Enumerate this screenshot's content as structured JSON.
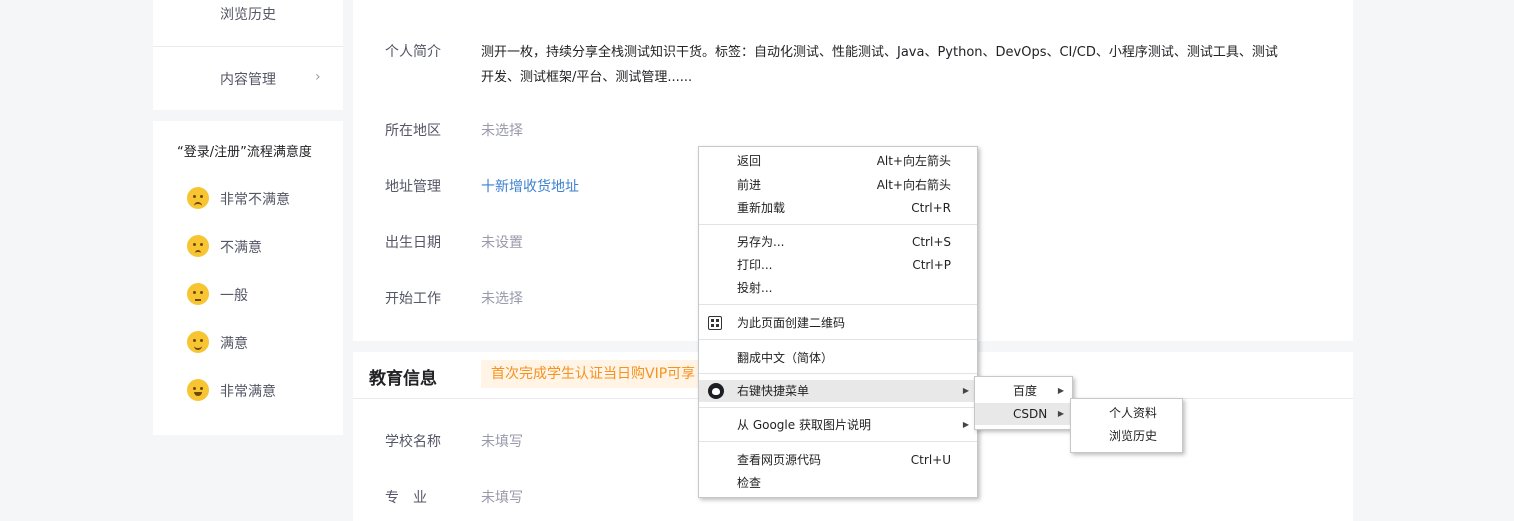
{
  "sidebar": {
    "items": [
      {
        "label": "浏览历史"
      },
      {
        "label": "内容管理",
        "chevron": "›"
      }
    ]
  },
  "survey": {
    "title": "“登录/注册”流程满意度",
    "options": [
      {
        "label": "非常不满意",
        "icon": "angry-face-icon"
      },
      {
        "label": "不满意",
        "icon": "worried-face-icon"
      },
      {
        "label": "一般",
        "icon": "neutral-face-icon"
      },
      {
        "label": "满意",
        "icon": "smile-face-icon"
      },
      {
        "label": "非常满意",
        "icon": "grin-face-icon"
      }
    ]
  },
  "profile": {
    "bio_label": "个人简介",
    "bio_value": "测开一枚，持续分享全栈测试知识干货。标签：自动化测试、性能测试、Java、Python、DevOps、CI/CD、小程序测试、测试工具、测试开发、测试框架/平台、测试管理......",
    "region_label": "所在地区",
    "region_value": "未选择",
    "address_label": "地址管理",
    "address_link": "十新增收货地址",
    "birth_label": "出生日期",
    "birth_value": "未设置",
    "work_label": "开始工作",
    "work_value": "未选择"
  },
  "education": {
    "title": "教育信息",
    "banner": "首次完成学生认证当日购VIP可享",
    "school_label": "学校名称",
    "school_value": "未填写",
    "major_label": "专　业",
    "major_value": "未填写"
  },
  "context_menu": {
    "back": {
      "label": "返回",
      "shortcut": "Alt+向左箭头"
    },
    "forward": {
      "label": "前进",
      "shortcut": "Alt+向右箭头"
    },
    "reload": {
      "label": "重新加载",
      "shortcut": "Ctrl+R"
    },
    "save_as": {
      "label": "另存为...",
      "shortcut": "Ctrl+S"
    },
    "print": {
      "label": "打印...",
      "shortcut": "Ctrl+P"
    },
    "cast": {
      "label": "投射..."
    },
    "qr": {
      "label": "为此页面创建二维码"
    },
    "translate": {
      "label": "翻成中文（简体）"
    },
    "quick_menu": {
      "label": "右键快捷菜单"
    },
    "google_image": {
      "label": "从 Google 获取图片说明"
    },
    "view_source": {
      "label": "查看网页源代码",
      "shortcut": "Ctrl+U"
    },
    "inspect": {
      "label": "检查"
    }
  },
  "submenu1": {
    "baidu": "百度",
    "csdn": "CSDN"
  },
  "submenu2": {
    "profile": "个人资料",
    "history": "浏览历史"
  }
}
